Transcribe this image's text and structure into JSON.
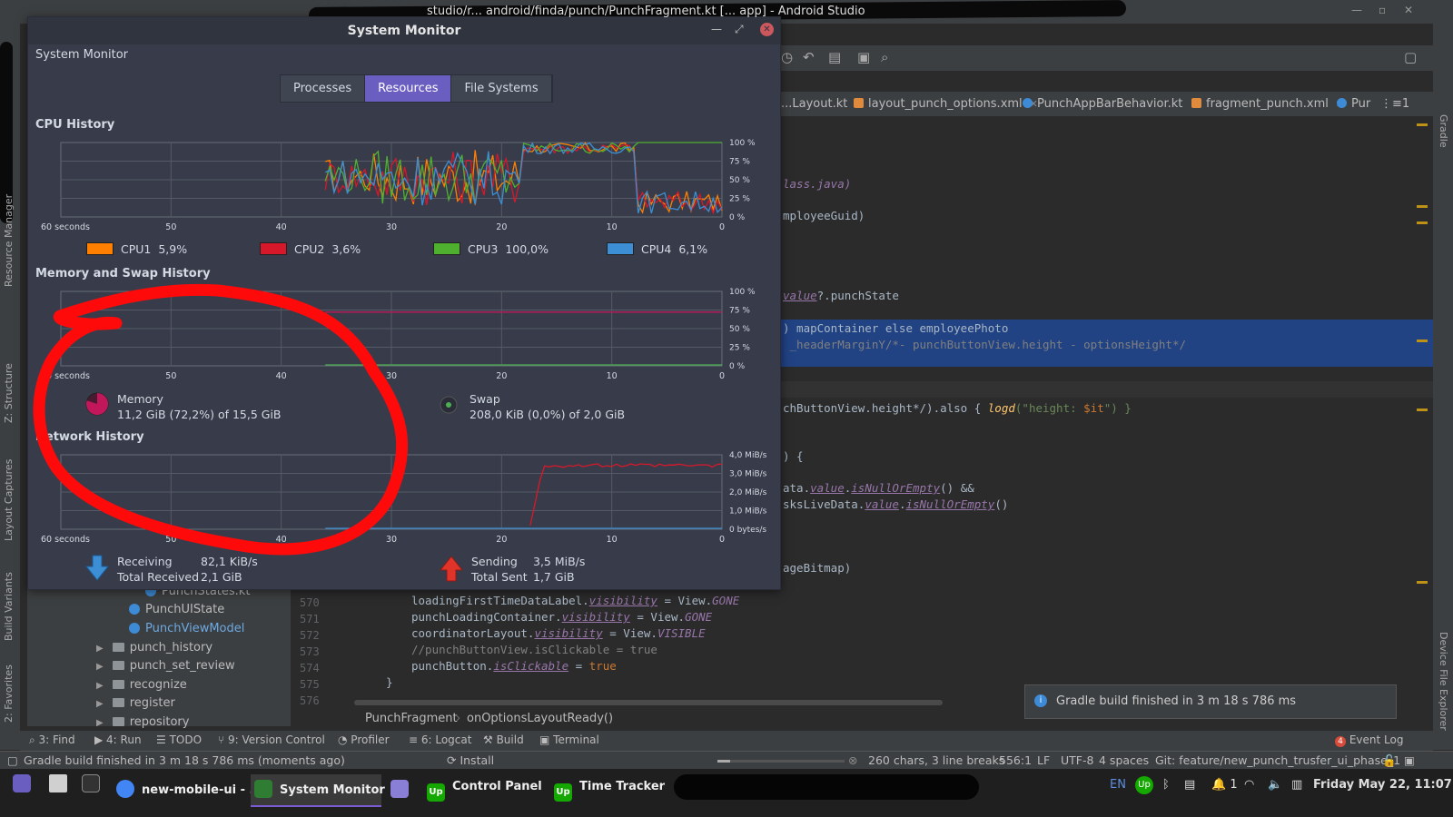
{
  "ide": {
    "window_title_path": "studio/r...  android/finda/punch/PunchFragment.kt [... app] - Android Studio",
    "left_tools": [
      "Resource Manager",
      "Z: Structure",
      "Layout Captures",
      "Build Variants",
      "2: Favorites"
    ],
    "right_tools": [
      "Gradle",
      "Device File Explorer"
    ],
    "file_tabs": [
      {
        "label": "...Layout.kt",
        "color": "#6897bb"
      },
      {
        "label": "layout_punch_options.xml",
        "color": "#e08a3e"
      },
      {
        "label": "PunchAppBarBehavior.kt",
        "color": "#3d8bd6"
      },
      {
        "label": "fragment_punch.xml",
        "color": "#e08a3e"
      },
      {
        "label": "Pur",
        "color": "#3d8bd6"
      }
    ],
    "code_fragments": {
      "l1": "lass.java)",
      "l2": "mployeeGuid)",
      "l3_a": "value",
      "l3_b": "?.punchState",
      "sel1": ") mapContainer else employeePhoto",
      "sel2": " _headerMarginY/*- punchButtonView.height - optionsHeight*/",
      "l4_a": "chButtonView.height*/).",
      "l4_b": "also",
      "l4_c": " { ",
      "l4_d": "logd",
      "l4_e": "(\"height: ",
      "l4_f": "$it",
      "l4_g": "\") }",
      "l5": ") {",
      "l6_a": "ata.",
      "l6_b": "value",
      "l6_c": ".",
      "l6_d": "isNullOrEmpty",
      "l6_e": "() &&",
      "l7_a": "sksLiveData.",
      "l7_b": "value",
      "l7_c": ".",
      "l7_d": "isNullOrEmpty",
      "l7_e": "()",
      "l8": "ageBitmap)"
    },
    "line_numbers": [
      "570",
      "571",
      "572",
      "573",
      "574",
      "575",
      "576"
    ],
    "code_lines": [
      {
        "a": "loadingFirstTimeDataLabel.",
        "b": "visibility",
        "c": " = View.",
        "d": "GONE"
      },
      {
        "a": "punchLoadingContainer.",
        "b": "visibility",
        "c": " = View.",
        "d": "GONE"
      },
      {
        "a": "coordinatorLayout.",
        "b": "visibility",
        "c": " = View.",
        "d": "VISIBLE"
      },
      {
        "comment": "//punchButtonView.isClickable = true"
      },
      {
        "a": "punchButton.",
        "b": "isClickable",
        "c": " = ",
        "kw": "true"
      },
      {
        "brace": "}"
      },
      {
        "brace": ""
      }
    ],
    "tree": [
      {
        "label": "PunchStates.kt",
        "kind": "kt",
        "level": 2
      },
      {
        "label": "PunchUIState",
        "kind": "kt",
        "level": 2
      },
      {
        "label": "PunchViewModel",
        "kind": "kt",
        "level": 2
      },
      {
        "label": "punch_history",
        "kind": "folder",
        "level": 1
      },
      {
        "label": "punch_set_review",
        "kind": "folder",
        "level": 1
      },
      {
        "label": "recognize",
        "kind": "folder",
        "level": 1
      },
      {
        "label": "register",
        "kind": "folder",
        "level": 1
      },
      {
        "label": "repository",
        "kind": "folder",
        "level": 1
      }
    ],
    "breadcrumbs": [
      "PunchFragment",
      "onOptionsLayoutReady()"
    ],
    "notification": "Gradle build finished in 3 m 18 s 786 ms",
    "bottom_tools": [
      "3: Find",
      "4: Run",
      "TODO",
      "9: Version Control",
      "Profiler",
      "6: Logcat",
      "Build",
      "Terminal"
    ],
    "event_log": "Event Log",
    "event_log_count": "4",
    "status": {
      "message": "Gradle build finished in 3 m 18 s 786 ms (moments ago)",
      "install": "Install",
      "chars": "260 chars, 3 line breaks",
      "position": "556:1",
      "line_sep": "LF",
      "encoding": "UTF-8",
      "indent": "4 spaces",
      "git": "Git: feature/new_punch_trusfer_ui_phase_1"
    }
  },
  "taskbar": {
    "tasks": [
      {
        "label": "new-mobile-ui - ...",
        "color": "#4285f4"
      },
      {
        "label": "System Monitor",
        "color": "#2e7d32",
        "active": true
      },
      {
        "label": "Control Panel",
        "color": "#14a800"
      },
      {
        "label": "Time Tracker",
        "color": "#14a800"
      }
    ],
    "tray_lang": "EN",
    "notif_count": "1",
    "clock": "Friday May 22, 11:07"
  },
  "sysmon": {
    "title": "System Monitor",
    "subtitle": "System Monitor",
    "tabs": [
      "Processes",
      "Resources",
      "File Systems"
    ],
    "active_tab": "Resources",
    "x_ticks": [
      "60 seconds",
      "50",
      "40",
      "30",
      "20",
      "10",
      "0"
    ],
    "cpu": {
      "section_title": "CPU History",
      "y_ticks": [
        "100 %",
        "75 %",
        "50 %",
        "25 %",
        "0 %"
      ],
      "legend": [
        {
          "label": "CPU1",
          "value": "5,9%",
          "color": "#ff7f00"
        },
        {
          "label": "CPU2",
          "value": "3,6%",
          "color": "#d7182a"
        },
        {
          "label": "CPU3",
          "value": "100,0%",
          "color": "#4fb030"
        },
        {
          "label": "CPU4",
          "value": "6,1%",
          "color": "#3c8fd4"
        }
      ]
    },
    "memory": {
      "section_title": "Memory and Swap History",
      "y_ticks": [
        "100 %",
        "75 %",
        "50 %",
        "25 %",
        "0 %"
      ],
      "memory_label": "Memory",
      "memory_value": "11,2 GiB (72,2%) of 15,5 GiB",
      "memory_color": "#c2185b",
      "swap_label": "Swap",
      "swap_value": "208,0 KiB (0,0%) of 2,0 GiB",
      "swap_color": "#4caf50"
    },
    "network": {
      "section_title": "Network History",
      "y_ticks": [
        "4,0 MiB/s",
        "3,0 MiB/s",
        "2,0 MiB/s",
        "1,0 MiB/s",
        "0 bytes/s"
      ],
      "receiving_label": "Receiving",
      "receiving_value": "82,1 KiB/s",
      "total_received_label": "Total Received",
      "total_received_value": "2,1 GiB",
      "sending_label": "Sending",
      "sending_value": "3,5 MiB/s",
      "total_sent_label": "Total Sent",
      "total_sent_value": "1,7 GiB",
      "receiving_color": "#3c8fd4",
      "sending_color": "#d7182a"
    }
  }
}
